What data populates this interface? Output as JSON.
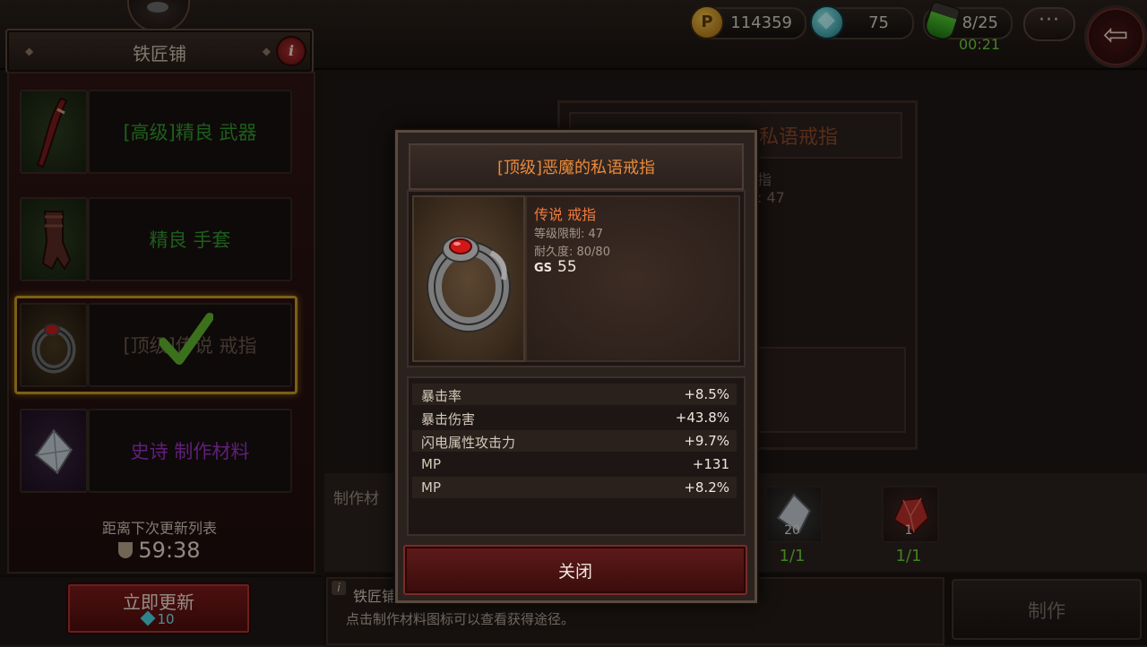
{
  "header": {
    "title": "铁匠铺",
    "currency": {
      "gold": "114359",
      "gems": "75",
      "stamina": "8/25",
      "stamina_timer": "00:21"
    },
    "menu_label": "···"
  },
  "recipes": [
    {
      "label": "[高级]精良 武器",
      "color": "#2f9a2c",
      "thumb": "dagger-icon"
    },
    {
      "label": "精良 手套",
      "color": "#2f9a2c",
      "thumb": "glove-icon"
    },
    {
      "label": "[顶级]传说 戒指",
      "color": "#6a5a4a",
      "thumb": "ring-icon",
      "selected": true
    },
    {
      "label": "史诗 制作材料",
      "color": "#9b33c4",
      "thumb": "crystal-icon"
    }
  ],
  "refresh": {
    "label": "距离下次更新列表",
    "time": "59:38",
    "button_label": "立即更新",
    "button_cost": "10"
  },
  "background_card": {
    "title": "私语戒指",
    "level_fragment": ": 47",
    "letter_fragment": "指"
  },
  "materials": {
    "label": "制作材",
    "items": [
      {
        "icon": "crystal-icon",
        "count": "20",
        "ratio": "1/1"
      },
      {
        "icon": "red-ore-icon",
        "count": "1",
        "ratio": "1/1"
      }
    ]
  },
  "info_bar": {
    "name": "铁匠铺",
    "hint": "点击制作材料图标可以查看获得途径。"
  },
  "make_button": "制作",
  "popup": {
    "title": "[顶级]恶魔的私语戒指",
    "rarity": "传说 戒指",
    "level": "等级限制: 47",
    "durability": "耐久度: 80/80",
    "gs_label": "GS",
    "gs_value": "55",
    "stats": [
      {
        "name": "暴击率",
        "value": "+8.5%"
      },
      {
        "name": "暴击伤害",
        "value": "+43.8%"
      },
      {
        "name": "闪电属性攻击力",
        "value": "+9.7%"
      },
      {
        "name": "MP",
        "value": "+131"
      },
      {
        "name": "MP",
        "value": "+8.2%"
      }
    ],
    "close_label": "关闭"
  }
}
